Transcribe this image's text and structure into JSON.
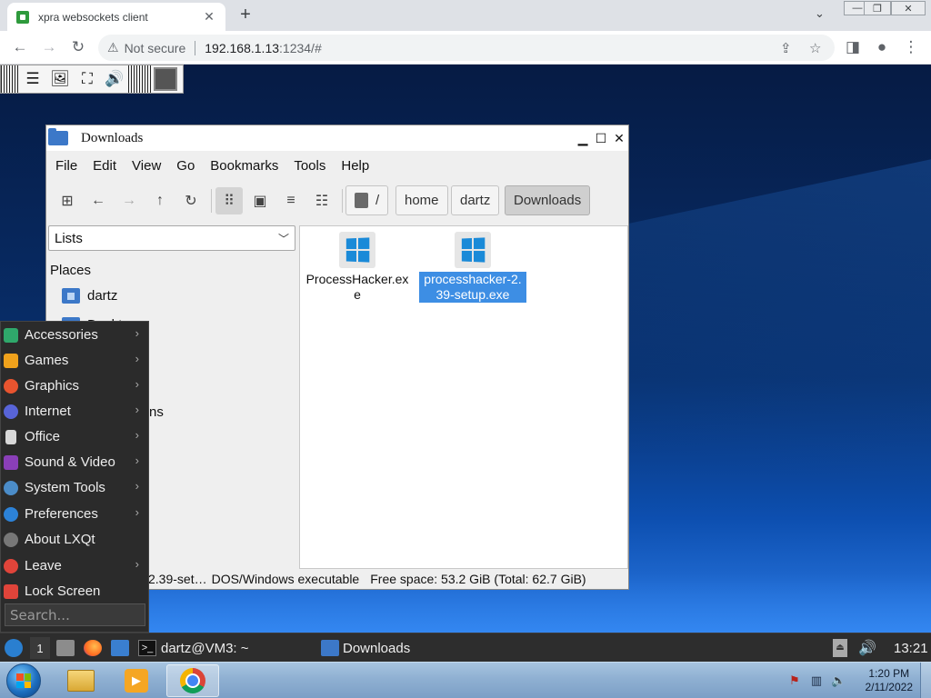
{
  "browser": {
    "tab_title": "xpra websockets client",
    "tab_close": "✕",
    "new_tab": "+",
    "not_secure": "Not secure",
    "url_host": "192.168.1.13",
    "url_rest": ":1234/#"
  },
  "file_manager": {
    "title": "Downloads",
    "menu": [
      "File",
      "Edit",
      "View",
      "Go",
      "Bookmarks",
      "Tools",
      "Help"
    ],
    "breadcrumb": [
      "/",
      "home",
      "dartz",
      "Downloads"
    ],
    "side_pane_mode": "Lists",
    "places_heading": "Places",
    "places": [
      "dartz",
      "Desktop"
    ],
    "places_partial": "ns",
    "files": [
      {
        "name": "ProcessHacker.exe",
        "selected": false
      },
      {
        "name": "processhacker-2.39-setup.exe",
        "selected": true
      }
    ],
    "status": {
      "selected_name": "2.39-set…",
      "type": "DOS/Windows executable",
      "free_space": "Free space: 53.2 GiB (Total: 62.7 GiB)"
    }
  },
  "start_menu": {
    "items": [
      {
        "label": "Accessories",
        "submenu": true,
        "color": "#2fa86b"
      },
      {
        "label": "Games",
        "submenu": true,
        "color": "#f0a21c"
      },
      {
        "label": "Graphics",
        "submenu": true,
        "color": "#e8542f"
      },
      {
        "label": "Internet",
        "submenu": true,
        "color": "#5864d8"
      },
      {
        "label": "Office",
        "submenu": true,
        "color": "#d8d8d8"
      },
      {
        "label": "Sound & Video",
        "submenu": true,
        "color": "#8a3fb8"
      },
      {
        "label": "System Tools",
        "submenu": true,
        "color": "#4b8cc8"
      },
      {
        "label": "Preferences",
        "submenu": true,
        "color": "#2c82d8"
      },
      {
        "label": "About LXQt",
        "submenu": false,
        "color": "#777777"
      },
      {
        "label": "Leave",
        "submenu": true,
        "color": "#e0443a"
      },
      {
        "label": "Lock Screen",
        "submenu": false,
        "color": "#e0443a"
      }
    ],
    "search_placeholder": "Search..."
  },
  "lxqt_panel": {
    "desktop_number": "1",
    "terminal_task": "dartz@VM3: ~",
    "files_task": "Downloads",
    "clock": "13:21"
  },
  "windows_taskbar": {
    "time": "1:20 PM",
    "date": "2/11/2022"
  }
}
